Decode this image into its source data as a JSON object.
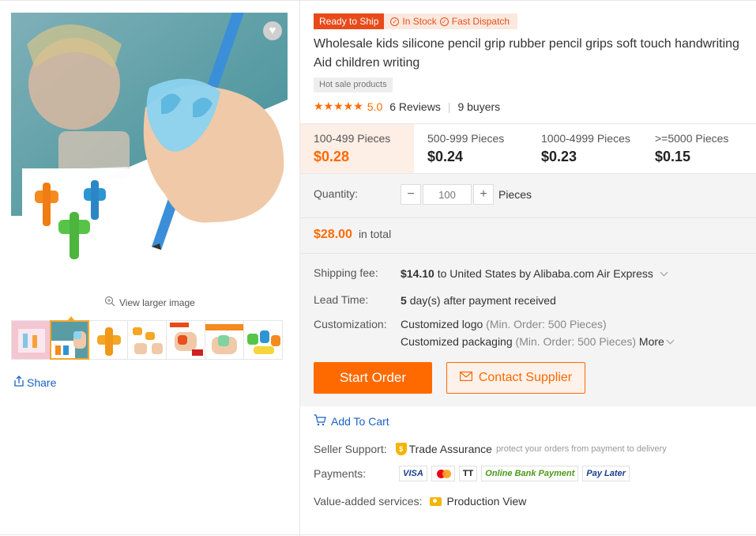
{
  "gallery": {
    "view_larger": "View larger image",
    "share_label": "Share",
    "thumbnail_count": 7,
    "active_thumbnail": 2
  },
  "badges": {
    "ready_to_ship": "Ready to Ship",
    "in_stock": "In Stock",
    "fast_dispatch": "Fast Dispatch"
  },
  "product": {
    "title": "Wholesale kids silicone pencil grip rubber pencil grips soft touch handwriting Aid children writing",
    "tag": "Hot sale products",
    "stars": "★★★★★",
    "rating": "5.0",
    "reviews": "6 Reviews",
    "buyers": "9 buyers"
  },
  "price_tiers": [
    {
      "quantity": "100-499 Pieces",
      "price": "$0.28"
    },
    {
      "quantity": "500-999 Pieces",
      "price": "$0.24"
    },
    {
      "quantity": "1000-4999 Pieces",
      "price": "$0.23"
    },
    {
      "quantity": ">=5000 Pieces",
      "price": "$0.15"
    }
  ],
  "order": {
    "quantity_label": "Quantity:",
    "quantity_placeholder": "100",
    "minus": "−",
    "plus": "+",
    "unit": "Pieces",
    "total_amount": "$28.00",
    "total_label": "in total"
  },
  "shipping": {
    "fee_label": "Shipping fee:",
    "fee_amount": "$14.10",
    "fee_detail": "to United States by Alibaba.com Air Express",
    "lead_label": "Lead Time:",
    "lead_days": "5",
    "lead_detail": "day(s) after payment received",
    "custom_label": "Customization:",
    "custom_logo": "Customized logo",
    "custom_logo_min": "(Min. Order: 500 Pieces)",
    "custom_pack": "Customized packaging",
    "custom_pack_min": "(Min. Order: 500 Pieces)",
    "more": "More"
  },
  "actions": {
    "start_order": "Start Order",
    "contact_supplier": "Contact Supplier",
    "add_to_cart": "Add To Cart"
  },
  "services": {
    "seller_support_label": "Seller Support:",
    "trade_assurance": "Trade Assurance",
    "trade_assurance_sub": "protect your orders from payment to delivery",
    "payments_label": "Payments:",
    "payments": [
      "VISA",
      "TT",
      "Online Bank Payment",
      "Pay Later"
    ],
    "vas_label": "Value-added services:",
    "production_view": "Production View"
  },
  "colors": {
    "accent": "#ff6a00",
    "rts_badge": "#e84a1a",
    "link": "#1a61c4"
  }
}
